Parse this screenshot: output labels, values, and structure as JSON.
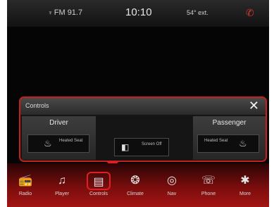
{
  "status_bar": {
    "radio": "FM 91.7",
    "time": "10:10",
    "temperature": "54° ext.",
    "icons": {
      "radio": "broadcast-icon",
      "phone": "phone-icon"
    }
  },
  "controls_popup": {
    "title": "Controls",
    "close_label": "✕",
    "driver": {
      "title": "Driver",
      "tile_label": "Heated Seat",
      "icon": "heated-seat-icon"
    },
    "center": {
      "tile_label": "Screen Off",
      "icon": "screen-off-icon"
    },
    "passenger": {
      "title": "Passenger",
      "tile_label": "Heated Seat",
      "icon": "heated-seat-icon"
    }
  },
  "dock": {
    "accent_color": "#e02020",
    "items": [
      {
        "label": "Radio",
        "icon": "radio-icon"
      },
      {
        "label": "Player",
        "icon": "player-icon"
      },
      {
        "label": "Controls",
        "icon": "controls-icon",
        "active": true
      },
      {
        "label": "Climate",
        "icon": "climate-icon"
      },
      {
        "label": "Nav",
        "icon": "nav-icon"
      },
      {
        "label": "Phone",
        "icon": "phone-icon"
      },
      {
        "label": "More",
        "icon": "more-icon"
      }
    ]
  }
}
